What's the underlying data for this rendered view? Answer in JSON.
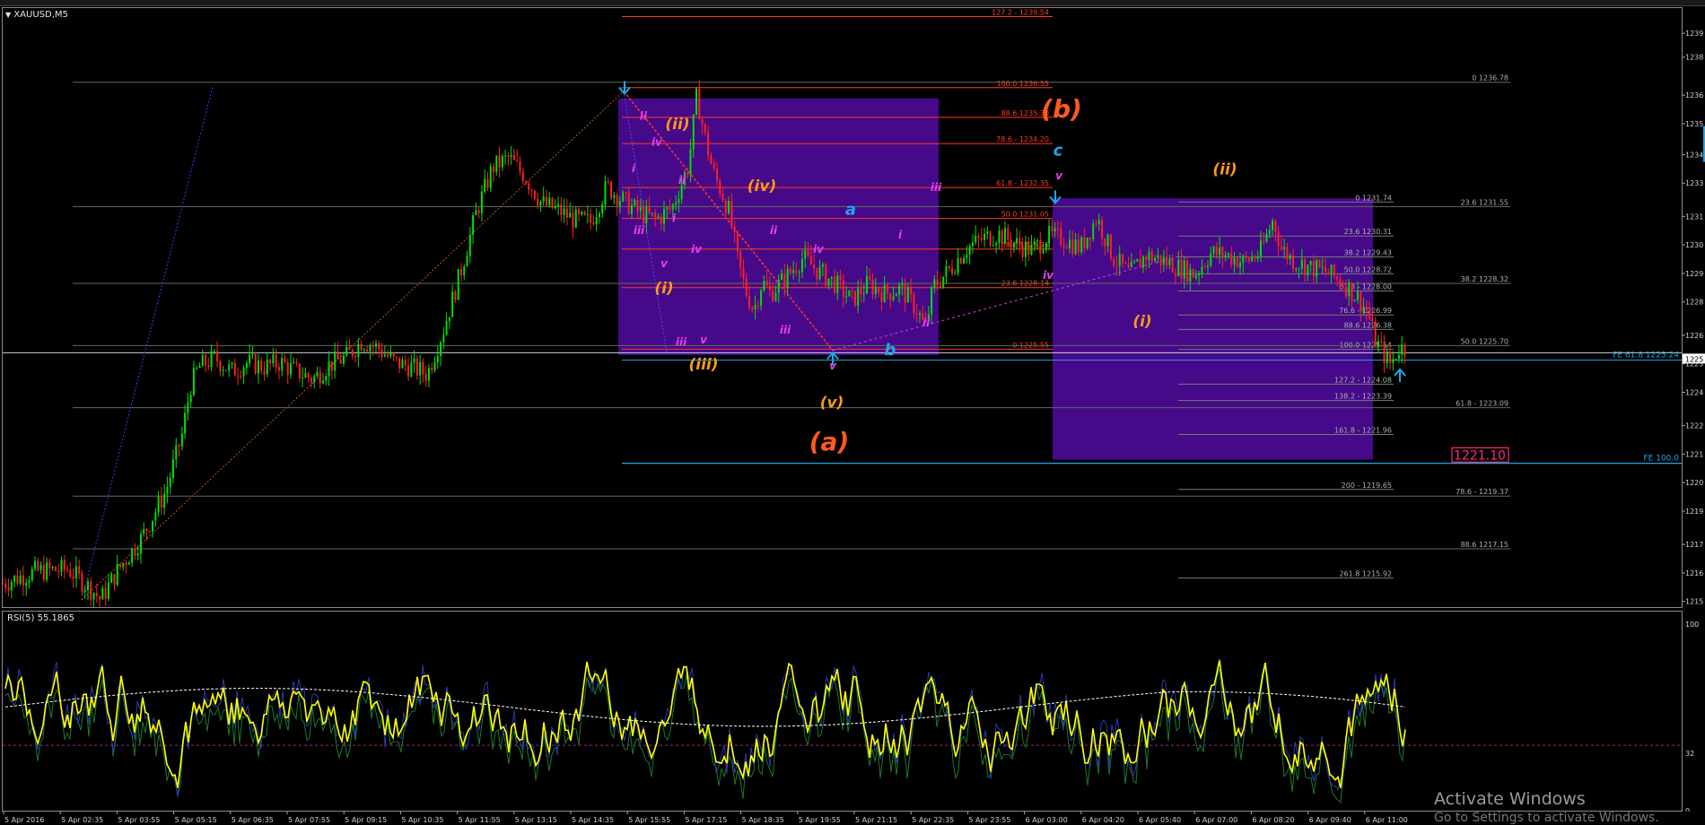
{
  "window": {
    "symbol_label": "XAUUSD,M5",
    "rsi_label": "RSI(5) 55.1865"
  },
  "colors": {
    "background": "#000000",
    "bull_candle": "#00e000",
    "bear_candle": "#ff2020",
    "fib_red": "#ff3b1f",
    "fib_gray": "#6f7f70",
    "zone_purple": "#4b0a96",
    "rsi_yellow": "#ffff00",
    "accent_cyan": "#1ea7e8",
    "wave_orange": "#ff9a1a",
    "wave_magenta": "#e83cf0",
    "price_tag_pink": "#ff2a7a"
  },
  "price_axis": {
    "labels": [
      "1239",
      "1238",
      "1236",
      "1235",
      "1234",
      "1233",
      "1231",
      "1230",
      "1229",
      "1228",
      "1226",
      "1225",
      "1224",
      "1222",
      "1221",
      "1220",
      "1219",
      "1217",
      "1216",
      "1215"
    ],
    "current_price": "1225"
  },
  "rsi_axis": {
    "labels": [
      "100",
      "32",
      "0"
    ]
  },
  "time_axis": {
    "labels": [
      "5 Apr 2016",
      "5 Apr 02:35",
      "5 Apr 03:55",
      "5 Apr 05:15",
      "5 Apr 06:35",
      "5 Apr 07:55",
      "5 Apr 09:15",
      "5 Apr 10:35",
      "5 Apr 11:55",
      "5 Apr 13:15",
      "5 Apr 14:35",
      "5 Apr 15:55",
      "5 Apr 17:15",
      "5 Apr 18:35",
      "5 Apr 19:55",
      "5 Apr 21:15",
      "5 Apr 22:35",
      "5 Apr 23:55",
      "6 Apr 03:00",
      "6 Apr 04:20",
      "6 Apr 05:40",
      "6 Apr 07:00",
      "6 Apr 08:20",
      "6 Apr 09:40",
      "6 Apr 11:00"
    ]
  },
  "fib_left": {
    "levels": [
      "127.2 - 1239.54",
      "100.0 1236.55",
      "88.6 1235.30",
      "78.6 - 1234.20",
      "61.8 - 1232.35",
      "50.0 1231.05",
      "38.2 1229.76",
      "23.6 1228.14",
      "0 1225.55"
    ]
  },
  "fib_right_inner": {
    "levels": [
      "0 1231.74",
      "23.6 1230.31",
      "38.2 1229.43",
      "50.0 1228.72",
      "61.8 - 1228.00",
      "76.6 - 1226.99",
      "88.6 1226.38",
      "100.0 1225.54",
      "127.2 - 1224.08",
      "138.2 - 1223.39",
      "161.8 - 1221.96",
      "200 - 1219.65",
      "261.8 1215.92"
    ]
  },
  "fib_right_outer": {
    "levels": [
      "0 1236.78",
      "23.6 1231.55",
      "38.2 1228.32",
      "50.0 1225.70",
      "61.8 - 1223.09",
      "78.6 - 1219.37",
      "88.6 1217.15"
    ]
  },
  "fe_labels": {
    "fe618": "FE 61.8 1225.24",
    "fe100": "FE 100.0"
  },
  "price_tag": "1221.10",
  "wave_labels": {
    "b_major": "(b)",
    "a_major": "(a)",
    "ii_orange": "(ii)",
    "iv_orange": "(iv)",
    "i_orange": "(i)",
    "iii_orange": "(iii)",
    "v_orange": "(v)",
    "ii_orange_right": "(ii)",
    "i_orange_right": "(i)",
    "a_cyan": "a",
    "b_cyan": "b",
    "c_cyan": "c",
    "m_ii_1": "ii",
    "m_iv_1": "iv",
    "m_i_1": "i",
    "m_ii_2": "ii",
    "m_iii_1": "iii",
    "m_i_2": "i",
    "m_v_1": "v",
    "m_iv_2": "iv",
    "m_iii_2": "iii",
    "m_v_2": "v",
    "m_ii_3": "ii",
    "m_iv_3": "iv",
    "m_iii_3": "iii",
    "m_v_3": "v",
    "m_i_3": "i",
    "m_ii_4": "ii",
    "m_iii_4": "iii",
    "m_v_4": "v",
    "m_iv_5": "iv"
  },
  "watermark": {
    "line1": "Activate Windows",
    "line2": "Go to Settings to activate Windows."
  },
  "chart_data": {
    "type": "candlestick",
    "symbol": "XAUUSD",
    "timeframe": "M5",
    "ylim": [
      1214.7,
      1239.9
    ],
    "x_start_label": "5 Apr 2016",
    "x_end_label": "6 Apr 11:00",
    "close_path": [
      [
        0,
        1215.7
      ],
      [
        20,
        1216.2
      ],
      [
        40,
        1216.3
      ],
      [
        55,
        1215.4
      ],
      [
        60,
        1215.0
      ],
      [
        70,
        1216.2
      ],
      [
        85,
        1217.6
      ],
      [
        100,
        1219.6
      ],
      [
        110,
        1222.0
      ],
      [
        115,
        1224.0
      ],
      [
        120,
        1224.8
      ],
      [
        130,
        1225.2
      ],
      [
        140,
        1224.6
      ],
      [
        150,
        1225.0
      ],
      [
        160,
        1224.8
      ],
      [
        170,
        1225.0
      ],
      [
        180,
        1224.6
      ],
      [
        190,
        1224.3
      ],
      [
        200,
        1224.9
      ],
      [
        210,
        1225.2
      ],
      [
        220,
        1225.9
      ],
      [
        230,
        1225.6
      ],
      [
        240,
        1225.0
      ],
      [
        250,
        1224.8
      ],
      [
        260,
        1224.5
      ],
      [
        270,
        1226.4
      ],
      [
        280,
        1228.7
      ],
      [
        290,
        1231.3
      ],
      [
        300,
        1233.2
      ],
      [
        310,
        1233.6
      ],
      [
        320,
        1232.8
      ],
      [
        330,
        1231.7
      ],
      [
        340,
        1231.4
      ],
      [
        350,
        1231.0
      ],
      [
        360,
        1230.9
      ],
      [
        370,
        1232.4
      ],
      [
        380,
        1231.8
      ],
      [
        390,
        1231.3
      ],
      [
        400,
        1231.0
      ],
      [
        410,
        1231.5
      ],
      [
        420,
        1233.3
      ],
      [
        425,
        1236.2
      ],
      [
        430,
        1234.5
      ],
      [
        435,
        1233.0
      ],
      [
        440,
        1232.2
      ],
      [
        445,
        1231.3
      ],
      [
        450,
        1229.3
      ],
      [
        455,
        1228.0
      ],
      [
        460,
        1227.2
      ],
      [
        465,
        1228.4
      ],
      [
        470,
        1227.9
      ],
      [
        480,
        1228.6
      ],
      [
        490,
        1229.4
      ],
      [
        500,
        1228.8
      ],
      [
        510,
        1228.3
      ],
      [
        520,
        1227.6
      ],
      [
        530,
        1228.3
      ],
      [
        540,
        1227.9
      ],
      [
        550,
        1228.1
      ],
      [
        560,
        1227.2
      ],
      [
        565,
        1226.4
      ],
      [
        570,
        1228.2
      ],
      [
        580,
        1228.9
      ],
      [
        590,
        1229.8
      ],
      [
        600,
        1230.2
      ],
      [
        610,
        1230.4
      ],
      [
        620,
        1230.0
      ],
      [
        630,
        1229.7
      ],
      [
        640,
        1230.3
      ],
      [
        650,
        1230.2
      ],
      [
        660,
        1229.8
      ],
      [
        670,
        1231.1
      ],
      [
        680,
        1229.4
      ],
      [
        690,
        1228.7
      ],
      [
        700,
        1229.5
      ],
      [
        710,
        1229.3
      ],
      [
        720,
        1229.0
      ],
      [
        730,
        1228.7
      ],
      [
        740,
        1229.6
      ],
      [
        750,
        1229.5
      ],
      [
        760,
        1229.2
      ],
      [
        770,
        1229.6
      ],
      [
        778,
        1231.0
      ],
      [
        783,
        1229.8
      ],
      [
        790,
        1229.3
      ],
      [
        800,
        1229.0
      ],
      [
        810,
        1228.8
      ],
      [
        820,
        1228.4
      ],
      [
        830,
        1227.7
      ],
      [
        836,
        1227.1
      ],
      [
        840,
        1226.0
      ],
      [
        845,
        1225.4
      ],
      [
        850,
        1224.9
      ],
      [
        855,
        1225.6
      ]
    ],
    "x_domain": [
      0,
      860
    ],
    "rsi": {
      "period": 5,
      "current": 55.1865,
      "level": 32,
      "ylim": [
        0,
        100
      ]
    }
  }
}
